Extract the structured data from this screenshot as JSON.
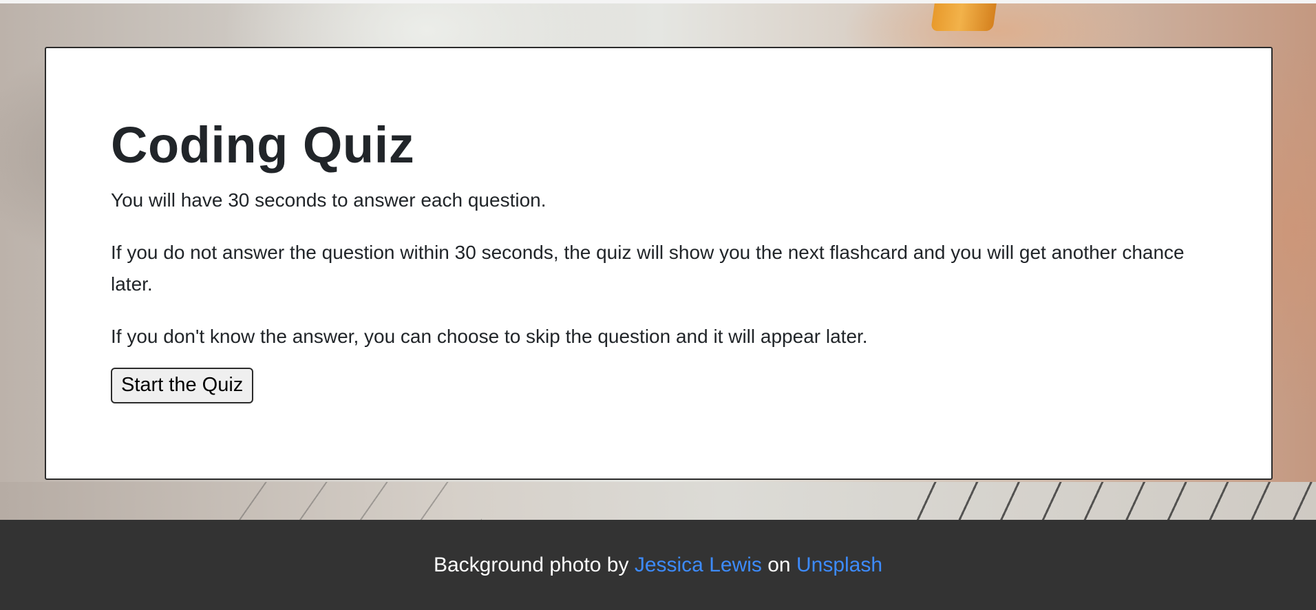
{
  "quiz": {
    "title": "Coding Quiz",
    "instructions": [
      "You will have 30 seconds to answer each question.",
      "If you do not answer the question within 30 seconds, the quiz will show you the next flashcard and you will get another chance later.",
      "If you don't know the answer, you can choose to skip the question and it will appear later."
    ],
    "start_button_label": "Start the Quiz"
  },
  "footer": {
    "prefix": "Background photo by",
    "photographer": "Jessica Lewis",
    "middle": "on",
    "site": "Unsplash"
  },
  "colors": {
    "footer_bg": "#333333",
    "link": "#3d8bfd",
    "text": "#212529",
    "card_bg": "#ffffff"
  }
}
